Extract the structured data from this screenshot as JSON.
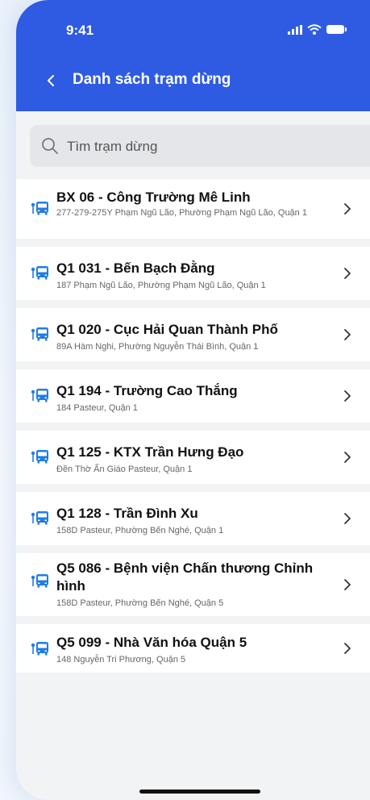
{
  "status": {
    "time": "9:41"
  },
  "header": {
    "title": "Danh sách trạm dừng"
  },
  "search": {
    "placeholder": "Tìm trạm dừng"
  },
  "stops": [
    {
      "name": "BX 06 - Công Trường Mê Linh",
      "address": "277-279-275Y Phạm Ngũ Lão, Phường Phạm Ngũ Lão, Quận 1"
    },
    {
      "name": "Q1 031 -  Bến Bạch Đằng",
      "address": "187 Phạm Ngũ Lão, Phường Phạm Ngũ Lão, Quận 1"
    },
    {
      "name": "Q1 020 - Cục Hải Quan Thành Phố",
      "address": "89A Hàm Nghi, Phường Nguyễn Thái Bình, Quận 1"
    },
    {
      "name": "Q1 194 - Trường Cao Thắng",
      "address": "184 Pasteur, Quận 1"
    },
    {
      "name": "Q1 125 - KTX Trần Hưng Đạo",
      "address": "Đền Thờ Ấn Giáo Pasteur, Quận 1"
    },
    {
      "name": "Q1 128 - Trần Đình Xu",
      "address": "158D Pasteur, Phường Bến Nghé, Quận 1"
    },
    {
      "name": "Q5 086 - Bệnh viện Chấn thương Chỉnh hình",
      "address": "158D Pasteur, Phường Bến Nghé, Quận 5"
    },
    {
      "name": "Q5 099 - Nhà Văn hóa Quận 5",
      "address": "148 Nguyễn Tri Phương, Quận 5"
    }
  ],
  "icons": {
    "back": "chevron-left-icon",
    "search": "search-icon",
    "stop": "bus-stop-icon",
    "row_action": "chevron-right-icon"
  },
  "colors": {
    "header": "#2f5be3",
    "bus_icon": "#1f7de6"
  }
}
